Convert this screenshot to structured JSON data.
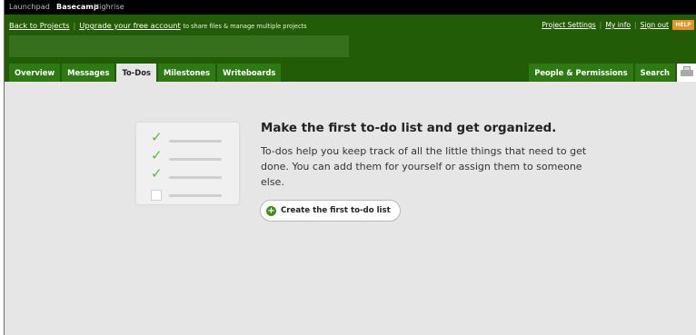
{
  "apps": [
    "Launchpad",
    "Basecamp",
    "Highrise"
  ],
  "active_app": "Basecamp",
  "header": {
    "back_link": "Back to Projects",
    "upgrade_link": "Upgrade your free account",
    "upgrade_note": "to share files & manage multiple projects",
    "right_links": [
      "Project Settings",
      "My info",
      "Sign out"
    ],
    "help": "HELP"
  },
  "tabs": [
    "Overview",
    "Messages",
    "To-Dos",
    "Milestones",
    "Writeboards"
  ],
  "active_tab": "To-Dos",
  "right_tabs": [
    "People & Permissions",
    "Search"
  ],
  "main": {
    "heading": "Make the first to-do list and get organized.",
    "description": "To-dos help you keep track of all the little things that need to get done. You can add them for yourself or assign them to someone else.",
    "create_button": "Create the first to-do list"
  },
  "colors": {
    "header_green": "#235c07",
    "tab_green": "#2d7a12",
    "content_gray": "#e6e6e6",
    "help_orange": "#e8922a",
    "check_green": "#5cb82c"
  },
  "icons": [
    "checkmark-icon",
    "plus-icon",
    "printer-icon"
  ]
}
